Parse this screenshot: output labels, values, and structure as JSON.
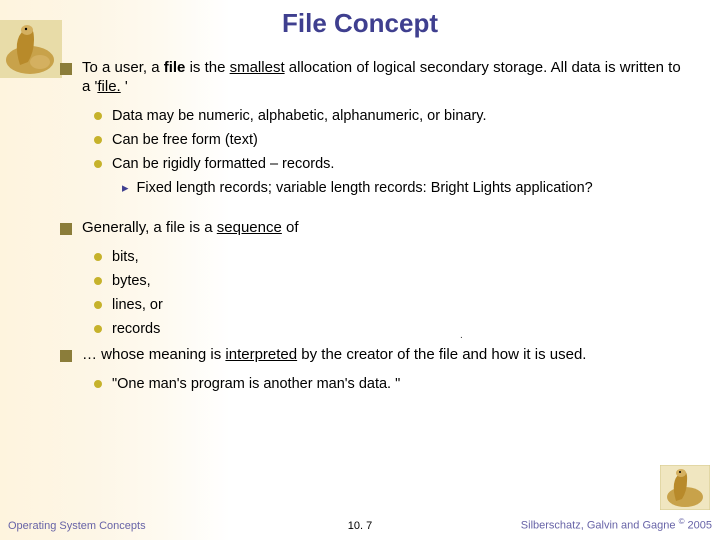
{
  "title": "File Concept",
  "bullets": {
    "b1_pre": "To a user, a ",
    "b1_bold1": "file",
    "b1_mid1": " is the ",
    "b1_ul1": "smallest",
    "b1_mid2": " allocation of logical secondary storage.  All data is written to a '",
    "b1_ul2": "file.",
    "b1_end": " '",
    "b1_s1": "Data may be numeric, alphabetic, alphanumeric, or binary.",
    "b1_s2": "Can be free form (text)",
    "b1_s3": "Can be rigidly formatted – records.",
    "b1_s3_a": "Fixed length records;  variable length records:  Bright Lights application?",
    "b2_pre": "Generally, a file is a ",
    "b2_ul": "sequence",
    "b2_post": " of",
    "b2_s1": "bits,",
    "b2_s2": "bytes,",
    "b2_s3": "lines, or",
    "b2_s4": "records",
    "b3_pre": "… whose meaning is  ",
    "b3_ul": "interpreted",
    "b3_post": " by the creator of the file and how it is used.",
    "b3_s1": "\"One man's program is another man's data. \""
  },
  "footer": {
    "left": "Operating System Concepts",
    "center": "10. 7",
    "right_a": "Silberschatz, Galvin and Gagne ",
    "right_b": "©",
    "right_c": " 2005"
  }
}
